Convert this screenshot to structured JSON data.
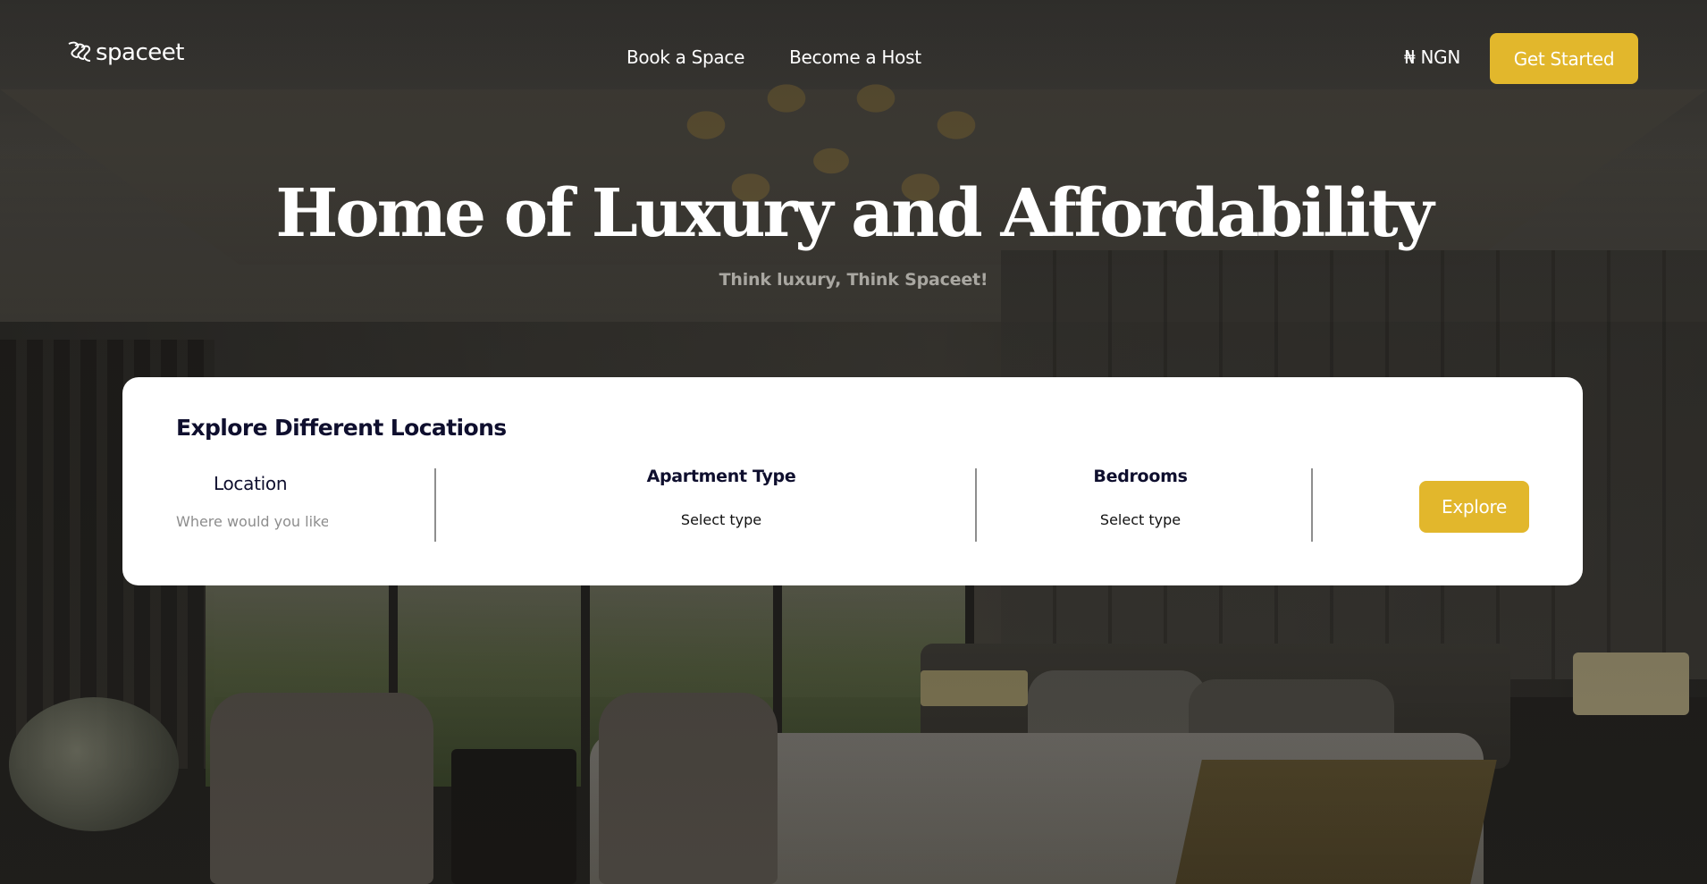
{
  "brand": {
    "name": "spaceet",
    "accent_color": "#e2b72c"
  },
  "header": {
    "nav": [
      {
        "label": "Book a Space"
      },
      {
        "label": "Become a Host"
      }
    ],
    "currency": "₦ NGN",
    "cta_label": "Get Started"
  },
  "hero": {
    "title": "Home of Luxury and Affordability",
    "subtitle": "Think luxury, Think Spaceet!"
  },
  "search": {
    "title": "Explore Different Locations",
    "location": {
      "label": "Location",
      "placeholder": "Where would you like to go?"
    },
    "apartment_type": {
      "label": "Apartment Type",
      "selected": "Select type"
    },
    "bedrooms": {
      "label": "Bedrooms",
      "selected": "Select type"
    },
    "explore_label": "Explore"
  }
}
